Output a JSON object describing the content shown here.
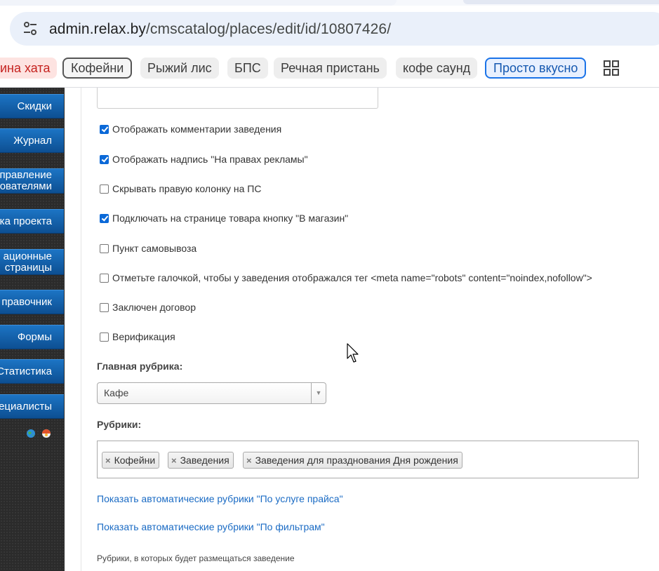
{
  "browser": {
    "url_host": "admin.relax.by",
    "url_path": "/cmscatalog/places/edit/id/10807426/",
    "site_info_icon": "tune-icon"
  },
  "bookmarks": [
    {
      "label": "ина хата",
      "style": "red"
    },
    {
      "label": "Кофейни",
      "style": "outline"
    },
    {
      "label": "Рыжий лис",
      "style": "grey"
    },
    {
      "label": "БПС",
      "style": "grey"
    },
    {
      "label": "Речная пристань",
      "style": "grey"
    },
    {
      "label": "кофе саунд",
      "style": "grey"
    },
    {
      "label": "Просто вкусно",
      "style": "blue"
    }
  ],
  "sidebar": {
    "items": [
      {
        "line1": "Скидки",
        "line2": ""
      },
      {
        "line1": "Журнал",
        "line2": ""
      },
      {
        "line1": "правление",
        "line2": "ователями"
      },
      {
        "line1": "ка проекта",
        "line2": ""
      },
      {
        "line1": "ационные",
        "line2": "страницы"
      },
      {
        "line1": "правочник",
        "line2": ""
      },
      {
        "line1": "Формы",
        "line2": ""
      },
      {
        "line1": "Статистика",
        "line2": ""
      },
      {
        "line1": "ециалисты",
        "line2": ""
      }
    ]
  },
  "options": [
    {
      "label": "Отображать комментарии заведения",
      "checked": true
    },
    {
      "label": "Отображать надпись \"На правах рекламы\"",
      "checked": true
    },
    {
      "label": "Скрывать правую колонку на ПС",
      "checked": false
    },
    {
      "label": "Подключать на странице товара кнопку \"В магазин\"",
      "checked": true
    },
    {
      "label": "Пункт самовывоза",
      "checked": false
    },
    {
      "label": "Отметьте галочкой, чтобы у заведения отображался тег <meta name=\"robots\" content=\"noindex,nofollow\">",
      "checked": false
    },
    {
      "label": "Заключен договор",
      "checked": false
    },
    {
      "label": "Верификация",
      "checked": false
    }
  ],
  "main_rubric": {
    "label": "Главная рубрика:",
    "value": "Кафе"
  },
  "rubrics": {
    "label": "Рубрики:",
    "chips": [
      "Кофейни",
      "Заведения",
      "Заведения для празднования Дня рождения"
    ],
    "chip_remove_glyph": "×",
    "link_price": "Показать автоматические рубрики \"По услуге прайса\"",
    "link_filters": "Показать автоматические рубрики \"По фильтрам\"",
    "hint": "Рубрики, в которых будет размещаться заведение"
  },
  "colors": {
    "sidebar_button": "#0d4f92",
    "checkbox_checked": "#0b69d8",
    "link": "#1a6bc4",
    "bookmark_blue": "#1a73e8"
  }
}
